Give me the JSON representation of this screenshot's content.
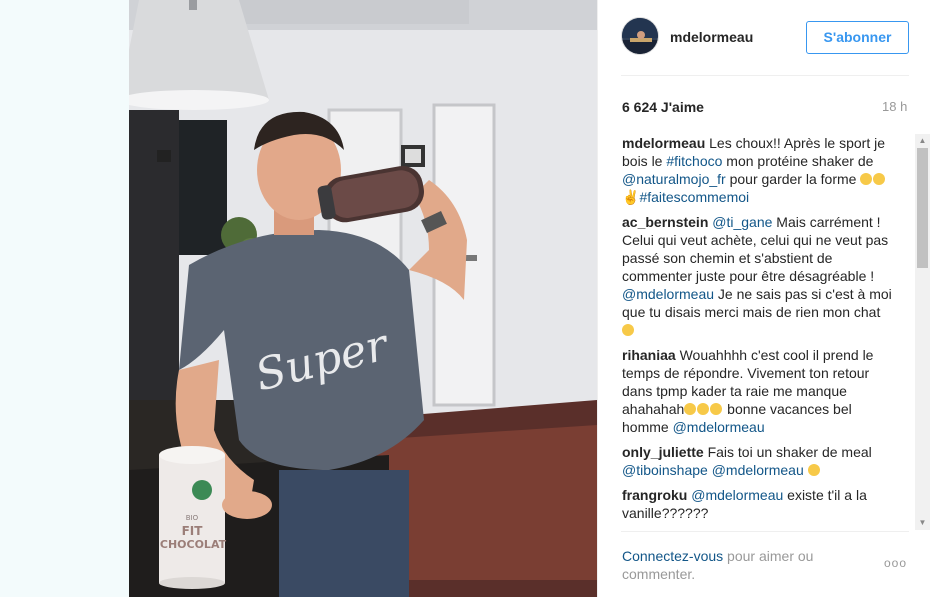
{
  "post": {
    "username": "mdelormeau",
    "follow_label": "S'abonner",
    "likes": "6 624 J'aime",
    "time": "18 h"
  },
  "photo": {
    "shirt_text": "Super",
    "tub_line1": "FIT",
    "tub_line2": "CHOCOLAT",
    "tub_brand": "BIO",
    "tub_badge": "natural mojo"
  },
  "comments": [
    {
      "user": "mdelormeau",
      "parts": [
        {
          "t": "Les choux!! Après le sport je bois le "
        },
        {
          "t": "#fitchoco",
          "link": true
        },
        {
          "t": " mon protéine shaker de "
        },
        {
          "t": "@naturalmojo_fr",
          "link": true
        },
        {
          "t": " pour garder la forme "
        },
        {
          "emoji": true
        },
        {
          "emoji": true
        },
        {
          "t": "✌"
        },
        {
          "t": "#faitescommemoi",
          "link": true
        }
      ]
    },
    {
      "user": "ac_bernstein",
      "parts": [
        {
          "t": "@ti_gane",
          "link": true
        },
        {
          "t": " Mais carrément ! Celui qui veut achète, celui qui ne veut pas passé son chemin et s'abstient de commenter juste pour être désagréable ! "
        },
        {
          "t": "@mdelormeau",
          "link": true
        },
        {
          "t": " Je ne sais pas si c'est à moi que tu disais merci mais de rien mon chat "
        },
        {
          "emoji": true
        }
      ]
    },
    {
      "user": "rihaniaa",
      "parts": [
        {
          "t": "Wouahhhh c'est cool il prend le temps de répondre. Vivement ton retour dans tpmp kader ta raie me manque ahahahah"
        },
        {
          "emoji": true
        },
        {
          "emoji": true
        },
        {
          "emoji": true
        },
        {
          "t": " bonne vacances bel homme "
        },
        {
          "t": "@mdelormeau",
          "link": true
        }
      ]
    },
    {
      "user": "only_juliette",
      "parts": [
        {
          "t": "Fais toi un shaker de meal "
        },
        {
          "t": "@tiboinshape",
          "link": true
        },
        {
          "t": " "
        },
        {
          "t": "@mdelormeau",
          "link": true
        },
        {
          "t": " "
        },
        {
          "emoji": true
        }
      ]
    },
    {
      "user": "frangroku",
      "parts": [
        {
          "t": "@mdelormeau",
          "link": true
        },
        {
          "t": " existe t'il a la vanille??????"
        }
      ]
    }
  ],
  "footer": {
    "login_link": "Connectez-vous",
    "login_rest": " pour aimer ou commenter.",
    "more_label": "ooo"
  },
  "colors": {
    "link": "#125688",
    "accent": "#3897f0",
    "muted": "#999999"
  }
}
